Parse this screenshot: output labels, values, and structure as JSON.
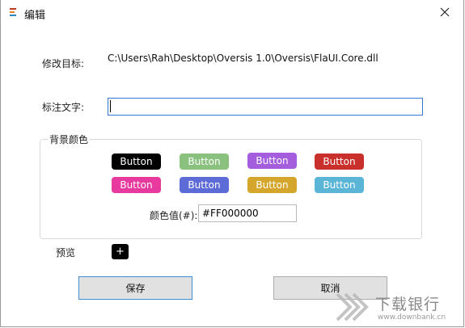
{
  "window": {
    "title": "编辑",
    "close_icon": "close-icon"
  },
  "form": {
    "target_label": "修改目标:",
    "target_value": "C:\\Users\\Rah\\Desktop\\Oversis 1.0\\Oversis\\FlaUI.Core.dll",
    "annotation_label": "标注文字:",
    "annotation_value": "",
    "bg_group_title": "背景颜色",
    "hex_label": "颜色值(#):",
    "hex_value": "#FF000000",
    "preview_label": "预览",
    "preview_glyph": "+"
  },
  "color_buttons": [
    {
      "label": "Button",
      "color": "#000000"
    },
    {
      "label": "Button",
      "color": "#8bc17e"
    },
    {
      "label": "Button",
      "color": "#a45ddc"
    },
    {
      "label": "Button",
      "color": "#c9302c"
    },
    {
      "label": "Button",
      "color": "#e8399e"
    },
    {
      "label": "Button",
      "color": "#5d6bd6"
    },
    {
      "label": "Button",
      "color": "#d4a72c"
    },
    {
      "label": "Button",
      "color": "#5bb5d6"
    }
  ],
  "actions": {
    "save_label": "保存",
    "cancel_label": "取消"
  },
  "watermark": {
    "title": "下载银行",
    "url": "www.downbank.cn"
  }
}
